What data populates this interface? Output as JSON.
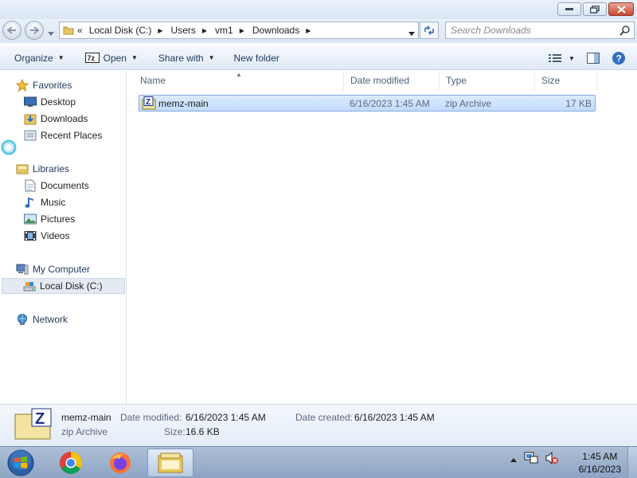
{
  "address": {
    "overflow": "«",
    "crumbs": [
      "Local Disk (C:)",
      "Users",
      "vm1",
      "Downloads"
    ]
  },
  "search": {
    "placeholder": "Search Downloads"
  },
  "toolbar": {
    "organize": "Organize",
    "open": "Open",
    "share_with": "Share with",
    "new_folder": "New folder"
  },
  "navpane": {
    "favorites": "Favorites",
    "desktop": "Desktop",
    "downloads": "Downloads",
    "recent_places": "Recent Places",
    "libraries": "Libraries",
    "documents": "Documents",
    "music": "Music",
    "pictures": "Pictures",
    "videos": "Videos",
    "my_computer": "My Computer",
    "local_disk": "Local Disk (C:)",
    "network": "Network"
  },
  "columns": {
    "name": "Name",
    "date_modified": "Date modified",
    "type": "Type",
    "size": "Size"
  },
  "files": [
    {
      "name": "memz-main",
      "date_modified": "6/16/2023 1:45 AM",
      "type": "zip Archive",
      "size": "17 KB"
    }
  ],
  "details": {
    "name": "memz-main",
    "type": "zip Archive",
    "date_modified_label": "Date modified:",
    "date_modified": "6/16/2023 1:45 AM",
    "date_created_label": "Date created:",
    "date_created": "6/16/2023 1:45 AM",
    "size_label": "Size:",
    "size": "16.6 KB"
  },
  "taskbar": {
    "time": "1:45 AM",
    "date": "6/16/2023"
  },
  "colors": {
    "accent": "#1e395b",
    "selection": "#c1dbfc",
    "taskbar": "#8ca4c4"
  }
}
